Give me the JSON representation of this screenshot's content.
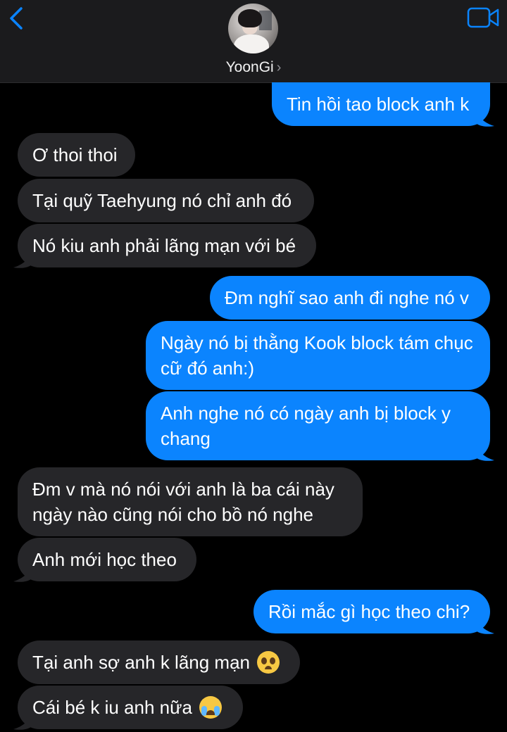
{
  "header": {
    "contact_name": "YoonGi",
    "chevron": "›",
    "back_icon": "chevron-left-icon",
    "video_icon": "video-camera-icon",
    "accent_color": "#0a84ff"
  },
  "messages": [
    {
      "direction": "outgoing",
      "text": "Tin hồi tao block anh k"
    },
    {
      "direction": "incoming",
      "text": "Ơ thoi thoi"
    },
    {
      "direction": "incoming",
      "text": "Tại quỹ Taehyung nó chỉ anh đó"
    },
    {
      "direction": "incoming",
      "text": "Nó kiu anh phải lãng mạn với bé"
    },
    {
      "direction": "outgoing",
      "text": "Đm nghĩ sao anh đi nghe nó v"
    },
    {
      "direction": "outgoing",
      "text": "Ngày nó bị thằng Kook block tám chục cữ đó anh:)"
    },
    {
      "direction": "outgoing",
      "text": "Anh nghe nó có ngày anh bị block y chang"
    },
    {
      "direction": "incoming",
      "text": "Đm v mà nó nói với anh là ba cái này ngày nào cũng nói cho bồ nó nghe"
    },
    {
      "direction": "incoming",
      "text": "Anh mới học theo"
    },
    {
      "direction": "outgoing",
      "text": "Rồi mắc gì học theo chi?"
    },
    {
      "direction": "incoming",
      "text": "Tại anh sợ anh k lãng mạn",
      "emoji": "pleading-face-emoji"
    },
    {
      "direction": "incoming",
      "text": "Cái bé k iu anh nữa",
      "emoji": "crying-face-emoji"
    }
  ],
  "colors": {
    "incoming_bubble": "#262629",
    "outgoing_bubble": "#0b84fe",
    "background": "#000000",
    "header_background": "#1b1b1d"
  }
}
